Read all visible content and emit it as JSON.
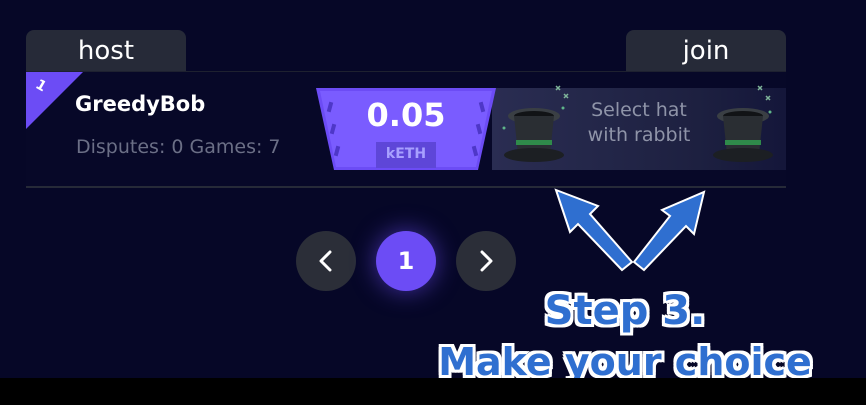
{
  "tabs": {
    "host_label": "host",
    "join_label": "join"
  },
  "game": {
    "rank": "1",
    "player_name": "GreedyBob",
    "stats": "Disputes: 0 Games: 7",
    "bet": {
      "value": "0.05",
      "unit": "kETH"
    },
    "hat_prompt": "Select hat with rabbit",
    "hat_icons": [
      "top-hat-icon",
      "top-hat-icon"
    ]
  },
  "pagination": {
    "current_page": "1",
    "prev_icon": "chevron-left-icon",
    "next_icon": "chevron-right-icon"
  },
  "annotation": {
    "step": "Step 3.",
    "instruction": "Make your choice"
  },
  "colors": {
    "background": "#060727",
    "accent": "#6c4cf5",
    "tab": "#262a38",
    "annotation_blue": "#2f6fd0"
  }
}
